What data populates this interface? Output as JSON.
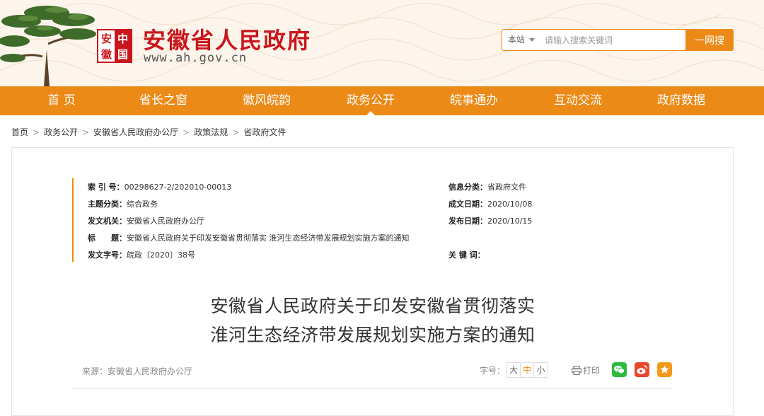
{
  "header": {
    "seal_chars": [
      "安",
      "中",
      "徽",
      "国"
    ],
    "site_title": "安徽省人民政府",
    "site_url": "www.ah.gov.cn"
  },
  "search": {
    "scope": "本站",
    "placeholder": "请输入搜索关键词",
    "button": "一网搜"
  },
  "nav": {
    "items": [
      "首 页",
      "省长之窗",
      "徽风皖韵",
      "政务公开",
      "皖事通办",
      "互动交流",
      "政府数据"
    ],
    "active": "政务公开"
  },
  "breadcrumb": [
    "首页",
    "政务公开",
    "安徽省人民政府办公厅",
    "政策法规",
    "省政府文件"
  ],
  "meta": {
    "index_key": "索 引 号：",
    "index_val": "00298627-2/202010-00013",
    "topic_key": "主题分类：",
    "topic_val": "综合政务",
    "issuer_key": "发文机关：",
    "issuer_val": "安徽省人民政府办公厅",
    "title_key": "标　　题：",
    "title_val": "安徽省人民政府关于印发安徽省贯彻落实 淮河生态经济带发展规划实施方案的通知",
    "docno_key": "发文字号：",
    "docno_val": "皖政〔2020〕38号",
    "category_key": "信息分类：",
    "category_val": "省政府文件",
    "created_key": "成文日期：",
    "created_val": "2020/10/08",
    "published_key": "发布日期：",
    "published_val": "2020/10/15",
    "keywords_key": "关 键 词：",
    "keywords_val": ""
  },
  "document": {
    "title_line1": "安徽省人民政府关于印发安徽省贯彻落实",
    "title_line2": "淮河生态经济带发展规划实施方案的通知",
    "source": "来源：安徽省人民政府办公厅"
  },
  "tools": {
    "font_label": "字号：",
    "sizes": [
      "大",
      "中",
      "小"
    ],
    "active_size": "中",
    "print": "打印"
  },
  "colors": {
    "brand_red": "#c9161d",
    "nav_orange": "#ec8a17",
    "wechat": "#2dba3f",
    "weibo": "#e8472b",
    "favorite": "#f39a1b"
  },
  "icons": [
    "pine-tree-icon",
    "search-dropdown-icon",
    "printer-icon",
    "wechat-icon",
    "weibo-icon",
    "favorite-icon"
  ]
}
